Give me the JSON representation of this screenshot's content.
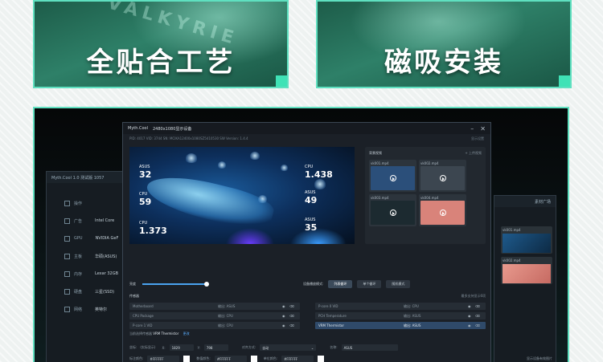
{
  "banners": {
    "left": {
      "text": "全贴合工艺",
      "brand": "VALKYRIE"
    },
    "right": {
      "text": "磁吸安装"
    }
  },
  "left_window": {
    "title": "Myth.Cool 1.0 测试版 1057",
    "rows": [
      {
        "label": "操作"
      },
      {
        "label": "广告",
        "value": "Intel Core"
      },
      {
        "label": "GPU",
        "value": "NVIDIA GeF"
      },
      {
        "label": "主板",
        "value": "华硕(ASUS)"
      },
      {
        "label": "内存",
        "value": "Lexar 32GB"
      },
      {
        "label": "硬盘",
        "value": "三星(SSD)"
      },
      {
        "label": "网络",
        "value": "英特尔"
      }
    ]
  },
  "main_window": {
    "app_name": "Myth.Cool",
    "title": "2480x1080显示设备",
    "info": "PID: 4017   VID: 3744   SN: MCIKA12400x1080SZ5410530   SW Version: 1.4.4",
    "info_right": "显示设置",
    "preview_stats": [
      {
        "label": "ASUS",
        "value": "32"
      },
      {
        "label": "CPU",
        "value": "59"
      },
      {
        "label": "CPU",
        "value": "1.373"
      },
      {
        "label": "CPU",
        "value": "1.438"
      },
      {
        "label": "ASUS",
        "value": "49"
      },
      {
        "label": "ASUS",
        "value": "35"
      }
    ],
    "gallery": {
      "title": "背景视频",
      "action": "+ 上传视频",
      "items": [
        {
          "name": "vk001.mp4",
          "color": "#2b4f7a"
        },
        {
          "name": "vk002.mp4",
          "color": "#3c4650"
        },
        {
          "name": "vk003.mp4",
          "color": "#1c2a30"
        },
        {
          "name": "vk004.mp4",
          "color": "#d9837a"
        }
      ]
    },
    "controls": {
      "brightness_label": "亮度",
      "mode_label": "设备播放模式:",
      "modes": [
        "列表循环",
        "单个循环",
        "随机模式"
      ]
    },
    "sensors": {
      "title": "传感器",
      "action": "最多支持显示6项",
      "rows": [
        {
          "name": "Motherboard",
          "source": "输出: ASUS"
        },
        {
          "name": "P-core 0 VID",
          "source": "输出: CPU"
        },
        {
          "name": "CPU Package",
          "source": "输出: CPU"
        },
        {
          "name": "PCH Temperature",
          "source": "输出: ASUS"
        },
        {
          "name": "P-core 1 VID",
          "source": "输出: CPU"
        },
        {
          "name": "VRM Thermistor",
          "source": "输出: ASUS"
        }
      ]
    },
    "display_line": {
      "prefix": "当前选择传感器",
      "name": "VRM Thermistor",
      "link": "更改"
    },
    "form": {
      "row1": {
        "pos_label": "坐标:",
        "pos_hint": "(实际显示)",
        "x_label": "X:",
        "x_value": "1829",
        "y_label": "Y:",
        "y_value": "798",
        "align_label": "对齐方式:",
        "align_value": "自动",
        "name_label": "名称:",
        "name_value": "ASUS"
      },
      "row2": {
        "c1_label": "标注颜色:",
        "c1_value": "#FFFFFF",
        "c2_label": "数值颜色:",
        "c2_value": "#FFFFFF",
        "c3_label": "单位颜色:",
        "c3_value": "#FFFFFF"
      }
    }
  },
  "right_window": {
    "title": "素材广场",
    "items": [
      {
        "name": "vk001.mp4"
      },
      {
        "name": "vk002.mp4"
      }
    ],
    "footer": "显示设备有效图片"
  }
}
